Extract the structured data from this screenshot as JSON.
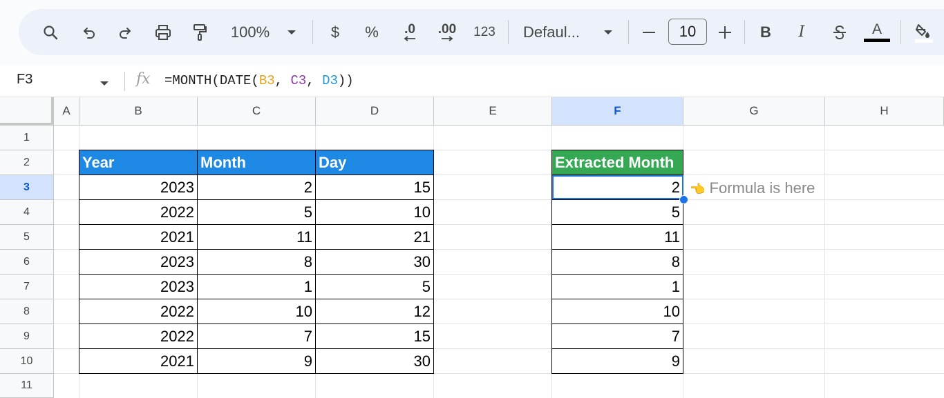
{
  "toolbar": {
    "zoom": "100%",
    "currency": "$",
    "percent": "%",
    "decrease_decimal": ".0",
    "increase_decimal": ".00",
    "number_format": "123",
    "font_name": "Defaul...",
    "font_size": "10",
    "minus": "−",
    "plus": "+",
    "bold": "B",
    "italic": "I",
    "text_color_letter": "A"
  },
  "formula_bar": {
    "cell_ref": "F3",
    "fx": "fx",
    "formula_prefix": "=MONTH(DATE(",
    "ref1": "B3",
    "comma1": ", ",
    "ref2": "C3",
    "comma2": ", ",
    "ref3": "D3",
    "formula_suffix": "))"
  },
  "columns": [
    "A",
    "B",
    "C",
    "D",
    "E",
    "F",
    "G",
    "H"
  ],
  "selected_column": "F",
  "rows": [
    "1",
    "2",
    "3",
    "4",
    "5",
    "6",
    "7",
    "8",
    "9",
    "10",
    "11"
  ],
  "selected_row": "3",
  "table": {
    "headers": [
      "Year",
      "Month",
      "Day"
    ],
    "rows": [
      [
        "2023",
        "2",
        "15"
      ],
      [
        "2022",
        "5",
        "10"
      ],
      [
        "2021",
        "11",
        "21"
      ],
      [
        "2023",
        "8",
        "30"
      ],
      [
        "2023",
        "1",
        "5"
      ],
      [
        "2022",
        "10",
        "12"
      ],
      [
        "2022",
        "7",
        "15"
      ],
      [
        "2021",
        "9",
        "30"
      ]
    ]
  },
  "extracted": {
    "header": "Extracted Month",
    "values": [
      "2",
      "5",
      "11",
      "8",
      "1",
      "10",
      "7",
      "9"
    ]
  },
  "annotation": {
    "pointer": "👈",
    "text": "Formula is here"
  },
  "colors": {
    "header_blue": "#1e88e5",
    "header_green": "#34a853",
    "selection": "#1a73e8"
  }
}
